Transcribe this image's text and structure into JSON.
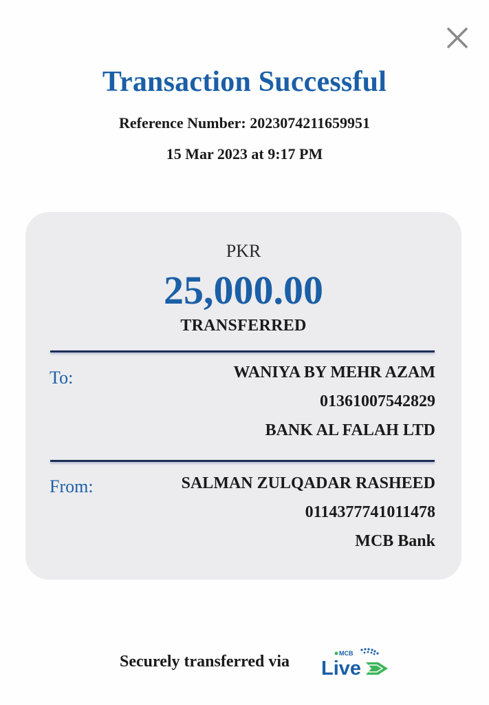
{
  "header": {
    "title": "Transaction Successful",
    "reference": "Reference Number: 2023074211659951",
    "datetime": "15 Mar 2023 at 9:17 PM"
  },
  "close_icon": "close-icon",
  "amount": {
    "currency": "PKR",
    "value": "25,000.00",
    "status": "TRANSFERRED"
  },
  "to": {
    "label": "To:",
    "name": "WANIYA BY MEHR AZAM",
    "account": "01361007542829",
    "bank": "BANK AL FALAH LTD"
  },
  "from": {
    "label": "From:",
    "name": "SALMAN ZULQADAR RASHEED",
    "account": "0114377741011478",
    "bank": "MCB Bank"
  },
  "footer": {
    "text": "Securely transferred via",
    "logo_badge": "MCB",
    "logo_word": "Live"
  },
  "colors": {
    "accent": "#1b5fa6",
    "card_bg": "#ececee",
    "divider": "#1d2e55",
    "logo_green": "#3cb55a"
  }
}
